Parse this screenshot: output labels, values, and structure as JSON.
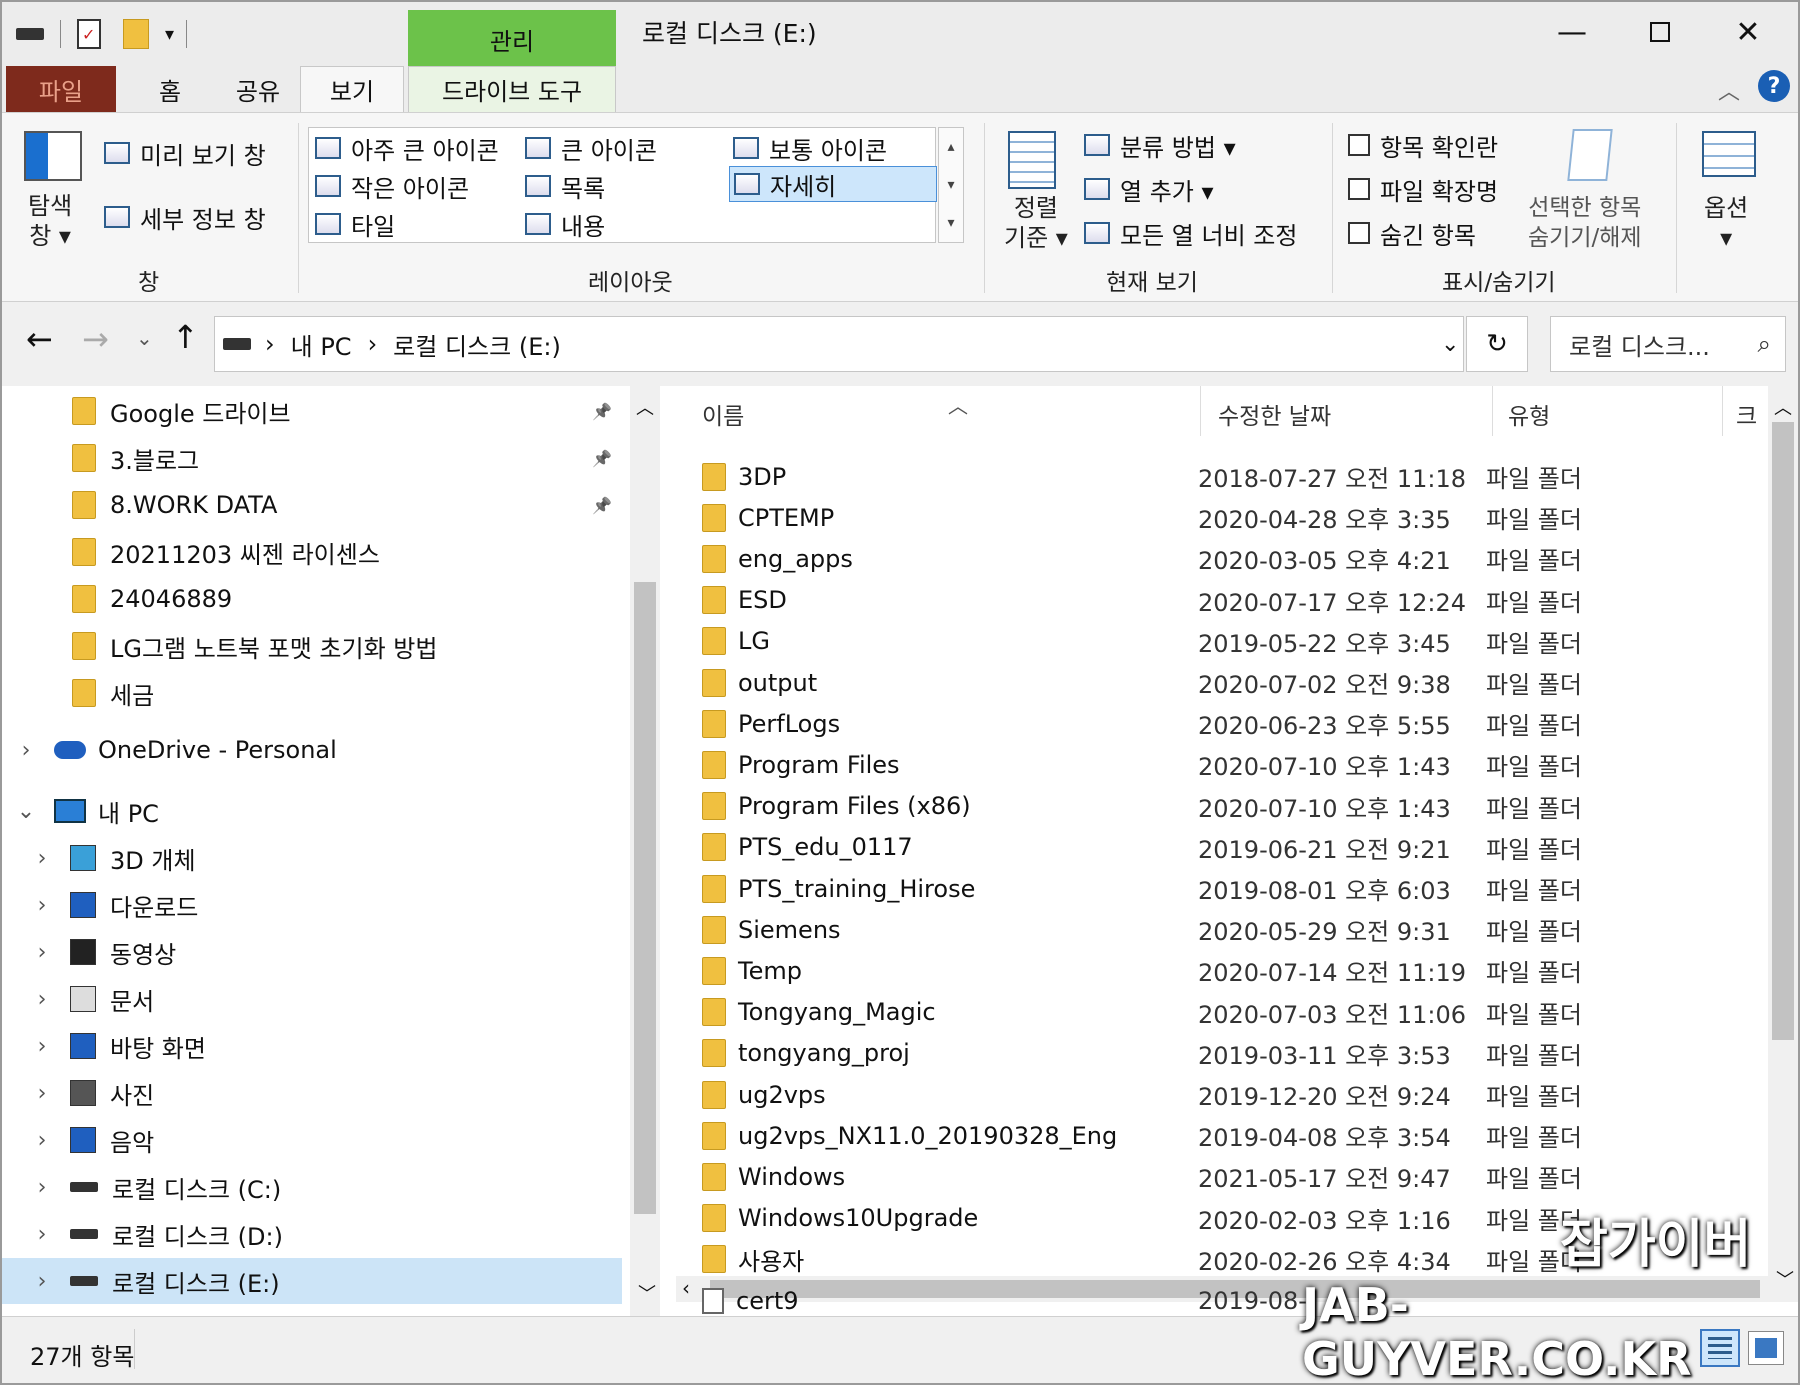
{
  "window": {
    "title": "로컬 디스크 (E:)",
    "context_group": "관리",
    "min": "—",
    "max": "☐",
    "close": "✕"
  },
  "tabs": {
    "file": "파일",
    "home": "홈",
    "share": "공유",
    "view": "보기",
    "drive_tools": "드라이브 도구"
  },
  "ribbon": {
    "panes": {
      "nav_pane": "탐색\n창",
      "nav_pane_line1": "탐색",
      "nav_pane_line2": "창 ▾",
      "preview": "미리 보기 창",
      "details": "세부 정보 창",
      "group": "창"
    },
    "layout": {
      "items": [
        "아주 큰 아이콘",
        "큰 아이콘",
        "보통 아이콘",
        "작은 아이콘",
        "목록",
        "자세히",
        "타일",
        "내용"
      ],
      "group": "레이아웃",
      "selected": "자세히"
    },
    "current_view": {
      "sort1": "정렬",
      "sort2": "기준 ▾",
      "group_by": "분류 방법 ▾",
      "add_col": "열 추가 ▾",
      "fit_cols": "모든 열 너비 조정",
      "group": "현재 보기"
    },
    "show_hide": {
      "item_check": "항목 확인란",
      "file_ext": "파일 확장명",
      "hidden": "숨긴 항목",
      "hide_sel1": "선택한 항목",
      "hide_sel2": "숨기기/해제",
      "group": "표시/숨기기"
    },
    "options": "옵션"
  },
  "address": {
    "pc": "내 PC",
    "drive": "로컬 디스크 (E:)",
    "search_placeholder": "로컬 디스크..."
  },
  "nav": {
    "quick": [
      {
        "label": "Google 드라이브",
        "pinned": true
      },
      {
        "label": "3.블로그",
        "pinned": true
      },
      {
        "label": "8.WORK DATA",
        "pinned": true
      },
      {
        "label": "20211203 씨젠 라이센스",
        "pinned": false
      },
      {
        "label": "24046889",
        "pinned": false
      },
      {
        "label": "LG그램 노트북 포맷 초기화 방법",
        "pinned": false
      },
      {
        "label": "세금",
        "pinned": false
      }
    ],
    "onedrive": "OneDrive - Personal",
    "pc": "내 PC",
    "pc_items": [
      "3D 개체",
      "다운로드",
      "동영상",
      "문서",
      "바탕 화면",
      "사진",
      "음악",
      "로컬 디스크 (C:)",
      "로컬 디스크 (D:)",
      "로컬 디스크 (E:)"
    ],
    "selected": "로컬 디스크 (E:)"
  },
  "list": {
    "headers": {
      "name": "이름",
      "modified": "수정한 날짜",
      "type": "유형",
      "size": "크"
    },
    "rows": [
      {
        "name": "3DP",
        "date": "2018-07-27 오전 11:18",
        "type": "파일 폴더"
      },
      {
        "name": "CPTEMP",
        "date": "2020-04-28 오후 3:35",
        "type": "파일 폴더"
      },
      {
        "name": "eng_apps",
        "date": "2020-03-05 오후 4:21",
        "type": "파일 폴더"
      },
      {
        "name": "ESD",
        "date": "2020-07-17 오후 12:24",
        "type": "파일 폴더"
      },
      {
        "name": "LG",
        "date": "2019-05-22 오후 3:45",
        "type": "파일 폴더"
      },
      {
        "name": "output",
        "date": "2020-07-02 오전 9:38",
        "type": "파일 폴더"
      },
      {
        "name": "PerfLogs",
        "date": "2020-06-23 오후 5:55",
        "type": "파일 폴더"
      },
      {
        "name": "Program Files",
        "date": "2020-07-10 오후 1:43",
        "type": "파일 폴더"
      },
      {
        "name": "Program Files (x86)",
        "date": "2020-07-10 오후 1:43",
        "type": "파일 폴더"
      },
      {
        "name": "PTS_edu_0117",
        "date": "2019-06-21 오전 9:21",
        "type": "파일 폴더"
      },
      {
        "name": "PTS_training_Hirose",
        "date": "2019-08-01 오후 6:03",
        "type": "파일 폴더"
      },
      {
        "name": "Siemens",
        "date": "2020-05-29 오전 9:31",
        "type": "파일 폴더"
      },
      {
        "name": "Temp",
        "date": "2020-07-14 오전 11:19",
        "type": "파일 폴더"
      },
      {
        "name": "Tongyang_Magic",
        "date": "2020-07-03 오전 11:06",
        "type": "파일 폴더"
      },
      {
        "name": "tongyang_proj",
        "date": "2019-03-11 오후 3:53",
        "type": "파일 폴더"
      },
      {
        "name": "ug2vps",
        "date": "2019-12-20 오전 9:24",
        "type": "파일 폴더"
      },
      {
        "name": "ug2vps_NX11.0_20190328_Eng",
        "date": "2019-04-08 오후 3:54",
        "type": "파일 폴더"
      },
      {
        "name": "Windows",
        "date": "2021-05-17 오전 9:47",
        "type": "파일 폴더"
      },
      {
        "name": "Windows10Upgrade",
        "date": "2020-02-03 오후 1:16",
        "type": "파일 폴더"
      },
      {
        "name": "사용자",
        "date": "2020-02-26 오후 4:34",
        "type": "파일 폴더"
      },
      {
        "name": "cert9",
        "date": "2019-08-",
        "type": ""
      }
    ]
  },
  "status": {
    "count": "27개 항목"
  },
  "watermark": {
    "line1": "잡가이버",
    "line2": "JAB-GUYVER.CO.KR"
  }
}
